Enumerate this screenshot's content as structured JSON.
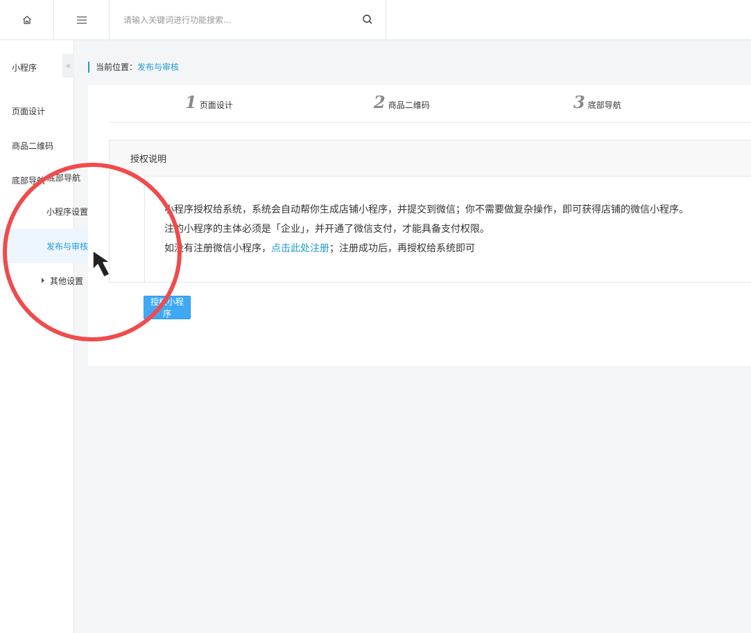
{
  "topbar": {
    "home_icon": "home-icon",
    "menu_icon": "hamburger-menu-icon",
    "search_placeholder": "请输入关键词进行功能搜索...",
    "search_icon": "search-icon"
  },
  "sidebar": {
    "title": "小程序",
    "collapse_symbol": "«",
    "items": [
      {
        "label": "页面设计"
      },
      {
        "label": "商品二维码"
      },
      {
        "label": "底部导航"
      }
    ],
    "submenu": {
      "title": "底部导航",
      "items": [
        {
          "label": "小程序设置"
        },
        {
          "label": "发布与审核",
          "active": true
        },
        {
          "label": "其他设置"
        }
      ]
    }
  },
  "breadcrumb": {
    "prefix": "当前位置：",
    "current": "发布与审核"
  },
  "steps": [
    {
      "num": "1",
      "label": "页面设计"
    },
    {
      "num": "2",
      "label": "商品二维码"
    },
    {
      "num": "3",
      "label": "底部导航"
    }
  ],
  "auth": {
    "title": "授权说明",
    "line1": "小程序授权给系统，系统会自动帮你生成店铺小程序，并提交到微信；你不需要做复杂操作，即可获得店铺的微信小程序。",
    "line2": "注的小程序的主体必须是「企业」，并开通了微信支付，才能具备支付权限。",
    "line3_prefix": "如没有注册微信小程序，",
    "line3_link": "点击此处注册",
    "line3_suffix": "；注册成功后，再授权给系统即可",
    "button_label": "授权小程序"
  },
  "colors": {
    "accent": "#1c9ad6",
    "button": "#3fa9f5",
    "annotation_circle": "#f04b4b"
  }
}
